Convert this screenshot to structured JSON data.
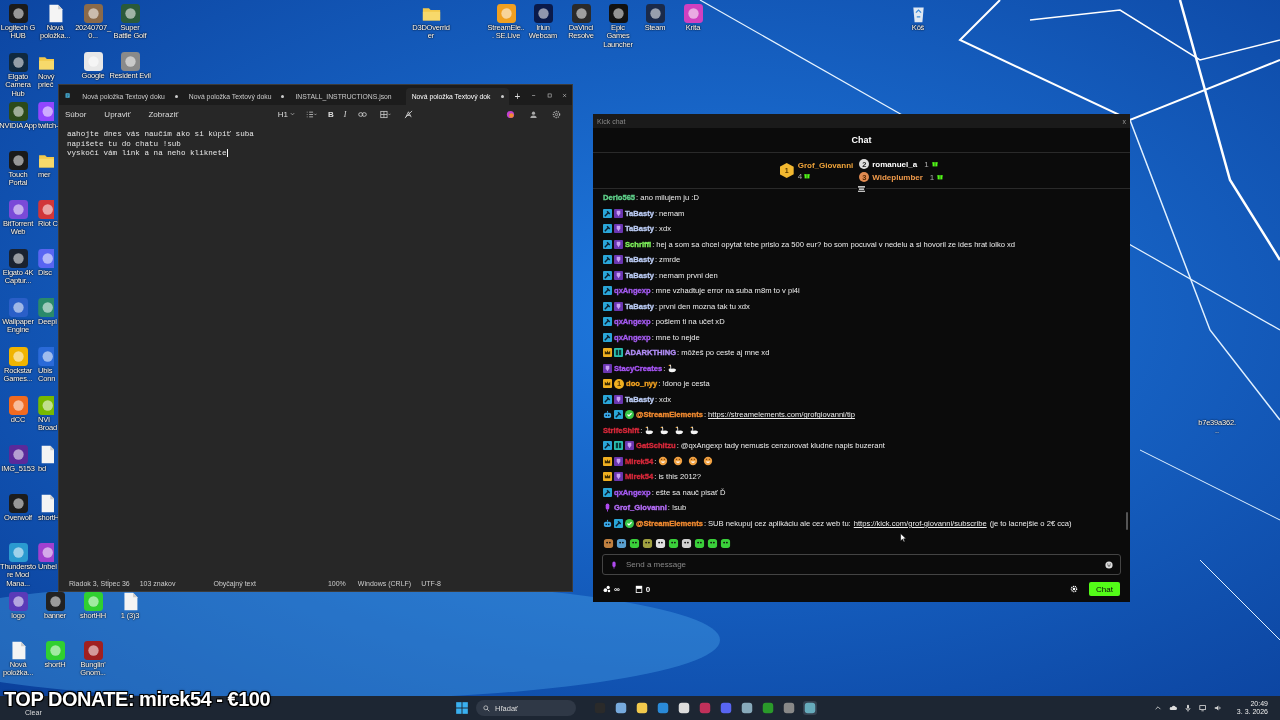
{
  "desktop_icons": [
    {
      "label": "Logitech G HUB",
      "kind": "app"
    },
    {
      "label": "Elgato Camera Hub",
      "kind": "app"
    },
    {
      "label": "NVIDIA App",
      "kind": "app"
    },
    {
      "label": "Touch Portal",
      "kind": "app"
    },
    {
      "label": "BitTorrent Web",
      "kind": "app"
    },
    {
      "label": "Elgato 4K Captur...",
      "kind": "app"
    },
    {
      "label": "Wallpaper Engine",
      "kind": "app"
    },
    {
      "label": "Rockstar Games...",
      "kind": "app"
    },
    {
      "label": "dCC",
      "kind": "app"
    },
    {
      "label": "IMG_5153",
      "kind": "app"
    },
    {
      "label": "Overwolf",
      "kind": "app"
    },
    {
      "label": "Thunderstore Mod Mana...",
      "kind": "app"
    },
    {
      "label": "logo",
      "kind": "app"
    },
    {
      "label": "Nová položka...",
      "kind": "file"
    },
    {
      "label": "Nová položka...",
      "kind": "file"
    },
    {
      "label": "Nový prieč",
      "kind": "folder"
    },
    {
      "label": "twitch-",
      "kind": "app"
    },
    {
      "label": "mer",
      "kind": "folder"
    },
    {
      "label": "Riot C",
      "kind": "app"
    },
    {
      "label": "Disc",
      "kind": "app"
    },
    {
      "label": "Deepl",
      "kind": "app"
    },
    {
      "label": "Ubis Conn",
      "kind": "app"
    },
    {
      "label": "NVI Broad",
      "kind": "app"
    },
    {
      "label": "bd",
      "kind": "file"
    },
    {
      "label": "shortH",
      "kind": "file"
    },
    {
      "label": "Unbel",
      "kind": "app"
    },
    {
      "label": "banner",
      "kind": "app"
    },
    {
      "label": "shortH",
      "kind": "app"
    },
    {
      "label": "20240707_0...",
      "kind": "app"
    },
    {
      "label": "Google",
      "kind": "app"
    },
    {
      "label": "shortHH",
      "kind": "app"
    },
    {
      "label": "Bunglin' Gnom...",
      "kind": "app"
    },
    {
      "label": "Super Battle Golf",
      "kind": "app"
    },
    {
      "label": "Resident Evil",
      "kind": "app"
    },
    {
      "label": "1 (3)3",
      "kind": "file"
    },
    {
      "label": "D3DOverrider",
      "kind": "folder"
    },
    {
      "label": "StreamEle... SE.Live",
      "kind": "app"
    },
    {
      "label": "Iriun Webcam",
      "kind": "app"
    },
    {
      "label": "DaVinci Resolve",
      "kind": "app"
    },
    {
      "label": "Epic Games Launcher",
      "kind": "app"
    },
    {
      "label": "Steam",
      "kind": "app"
    },
    {
      "label": "Krita",
      "kind": "app"
    },
    {
      "label": "Kôš",
      "kind": "bin"
    },
    {
      "label": "b7e39a362...",
      "kind": "blank"
    }
  ],
  "notepad": {
    "tabs": [
      {
        "label": "Nová položka Textový doku",
        "modified": true,
        "selected": false
      },
      {
        "label": "Nová položka Textový doku",
        "modified": true,
        "selected": false
      },
      {
        "label": "INSTALL_INSTRUCTIONS.json",
        "modified": false,
        "selected": false
      },
      {
        "label": "Nová položka Textový dok",
        "modified": true,
        "selected": true
      }
    ],
    "new_tab": "+",
    "menu": [
      "Súbor",
      "Upraviť",
      "Zobraziť"
    ],
    "toolbar": [
      {
        "kind": "heading",
        "label": "H1"
      },
      {
        "kind": "list"
      },
      {
        "kind": "bold",
        "label": "B"
      },
      {
        "kind": "italic",
        "label": "I"
      },
      {
        "kind": "link"
      },
      {
        "kind": "table"
      },
      {
        "kind": "clear"
      }
    ],
    "lines": [
      "aahojte dnes vás naučim ako si kúpiť suba",
      "napíšete tu do chatu !sub",
      "vyskočí vám link a na neho kliknete"
    ],
    "status": [
      "Riadok 3, Stĺpec 36",
      "103 znakov",
      "Obyčajný text",
      "100%",
      "Windows (CRLF)",
      "UTF-8"
    ]
  },
  "chat": {
    "window_title": "Kick chat",
    "close": "x",
    "title": "Chat",
    "leaderboard": [
      {
        "rank": "1",
        "name": "Grof_Giovanni",
        "count": "4",
        "color": "#f0a43a"
      },
      {
        "rank": "2",
        "name": "romanuel_a",
        "count": "1",
        "color": "#ffffff"
      },
      {
        "rank": "3",
        "name": "Wideplumber",
        "count": "1",
        "color": "#f09a4a"
      }
    ],
    "messages": [
      {
        "user": "Derio565",
        "color": "#5fd08a",
        "parts": [
          {
            "kind": "text",
            "text": "ano milujem ju :D"
          }
        ]
      },
      {
        "user": "TaBasty",
        "color": "#b8c8f0",
        "badges": [
          {
            "kind": "mod"
          },
          {
            "kind": "sub"
          }
        ],
        "parts": [
          {
            "kind": "text",
            "text": "nemam"
          }
        ]
      },
      {
        "user": "TaBasty",
        "color": "#b8c8f0",
        "badges": [
          {
            "kind": "mod"
          },
          {
            "kind": "sub"
          }
        ],
        "parts": [
          {
            "kind": "text",
            "text": "xdx"
          }
        ]
      },
      {
        "user": "Schriffi",
        "color": "#7ef05a",
        "badges": [
          {
            "kind": "mod"
          },
          {
            "kind": "sub"
          }
        ],
        "parts": [
          {
            "kind": "text",
            "text": "hej a som sa chcel opytat tebe prislo za 500 eur? bo som pocuval v nedelu a si hovoril ze ides hrat lolko xd"
          }
        ]
      },
      {
        "user": "TaBasty",
        "color": "#b8c8f0",
        "badges": [
          {
            "kind": "mod"
          },
          {
            "kind": "sub"
          }
        ],
        "parts": [
          {
            "kind": "text",
            "text": "zmrde"
          }
        ]
      },
      {
        "user": "TaBasty",
        "color": "#b8c8f0",
        "badges": [
          {
            "kind": "mod"
          },
          {
            "kind": "sub"
          }
        ],
        "parts": [
          {
            "kind": "text",
            "text": "nemam prvni den"
          }
        ]
      },
      {
        "user": "qxAngexp",
        "color": "#a45af0",
        "badges": [
          {
            "kind": "mod"
          }
        ],
        "parts": [
          {
            "kind": "text",
            "text": "mne vzhadtuje error na suba m8m to v pi4i"
          }
        ]
      },
      {
        "user": "TaBasty",
        "color": "#b8c8f0",
        "badges": [
          {
            "kind": "mod"
          },
          {
            "kind": "sub"
          }
        ],
        "parts": [
          {
            "kind": "text",
            "text": "prvni den mozna tak tu xdx"
          }
        ]
      },
      {
        "user": "qxAngexp",
        "color": "#a45af0",
        "badges": [
          {
            "kind": "mod"
          }
        ],
        "parts": [
          {
            "kind": "text",
            "text": "pošlem ti na učet xD"
          }
        ]
      },
      {
        "user": "qxAngexp",
        "color": "#a45af0",
        "badges": [
          {
            "kind": "mod"
          }
        ],
        "parts": [
          {
            "kind": "text",
            "text": "mne to nejde"
          }
        ]
      },
      {
        "user": "ADARKTHING",
        "color": "#b08cf5",
        "badges": [
          {
            "kind": "vip"
          },
          {
            "kind": "og"
          }
        ],
        "parts": [
          {
            "kind": "text",
            "text": "môžeš po ceste aj mne xd"
          }
        ]
      },
      {
        "user": "StacyCreates",
        "color": "#a855f7",
        "badges": [
          {
            "kind": "sub"
          }
        ],
        "parts": [
          {
            "kind": "goose"
          }
        ]
      },
      {
        "user": "doo_nyy",
        "color": "#f0a020",
        "badges": [
          {
            "kind": "vip"
          },
          {
            "kind": "gifter",
            "label": "1"
          }
        ],
        "parts": [
          {
            "kind": "text",
            "text": "!dono je cesta"
          }
        ]
      },
      {
        "user": "TaBasty",
        "color": "#b8c8f0",
        "badges": [
          {
            "kind": "mod"
          },
          {
            "kind": "sub"
          }
        ],
        "parts": [
          {
            "kind": "text",
            "text": "xdx"
          }
        ]
      },
      {
        "user": "@StreamElements",
        "color": "#f08a30",
        "badges": [
          {
            "kind": "bot"
          },
          {
            "kind": "mod"
          },
          {
            "kind": "verified"
          }
        ],
        "parts": [
          {
            "kind": "link",
            "text": "https://streamelements.com/grofgiovanni/tip"
          }
        ]
      },
      {
        "user": "StrifeShift",
        "color": "#d8283a",
        "parts": [
          {
            "kind": "goose"
          },
          {
            "kind": "goose"
          },
          {
            "kind": "goose"
          },
          {
            "kind": "goose"
          }
        ]
      },
      {
        "user": "GatSchitzu",
        "color": "#d8283a",
        "badges": [
          {
            "kind": "mod"
          },
          {
            "kind": "og"
          },
          {
            "kind": "sub"
          }
        ],
        "parts": [
          {
            "kind": "text",
            "text": "@qxAngexp tady nemusis cenzurovat kludne napis buzerant"
          }
        ]
      },
      {
        "user": "Mirek54",
        "color": "#d8283a",
        "badges": [
          {
            "kind": "vip"
          },
          {
            "kind": "sub"
          }
        ],
        "parts": [
          {
            "kind": "grin"
          },
          {
            "kind": "grin"
          },
          {
            "kind": "grin"
          },
          {
            "kind": "grin"
          }
        ]
      },
      {
        "user": "Mirek54",
        "color": "#d8283a",
        "badges": [
          {
            "kind": "vip"
          },
          {
            "kind": "sub"
          }
        ],
        "parts": [
          {
            "kind": "text",
            "text": "is this 2012?"
          }
        ]
      },
      {
        "user": "qxAngexp",
        "color": "#a45af0",
        "badges": [
          {
            "kind": "mod"
          }
        ],
        "parts": [
          {
            "kind": "text",
            "text": "ešte sa nauč pisať Ď"
          }
        ]
      },
      {
        "user": "Grof_Giovanni",
        "color": "#b36bf5",
        "badges": [
          {
            "kind": "broadcaster"
          }
        ],
        "parts": [
          {
            "kind": "text",
            "text": "!sub"
          }
        ]
      },
      {
        "user": "@StreamElements",
        "color": "#f08a30",
        "badges": [
          {
            "kind": "bot"
          },
          {
            "kind": "mod"
          },
          {
            "kind": "verified"
          }
        ],
        "parts": [
          {
            "kind": "text",
            "text": "SUB nekupuj cez aplikáciu ale cez web tu:"
          },
          {
            "kind": "link",
            "text": "https://kick.com/grof-giovanni/subscribe"
          },
          {
            "kind": "text",
            "text": "(je to lacnejšie o 2€ cca)"
          }
        ]
      }
    ],
    "separator": ":",
    "input_placeholder": "Send a message",
    "points": "∞",
    "store_count": "0",
    "send_button": "Chat"
  },
  "taskbar": {
    "search_placeholder": "Hľadať",
    "time": "20:49",
    "date": "3. 3. 2026"
  },
  "overlay": {
    "text": "TOP DONATE: mirek54 - €100",
    "caption": "Clear"
  }
}
